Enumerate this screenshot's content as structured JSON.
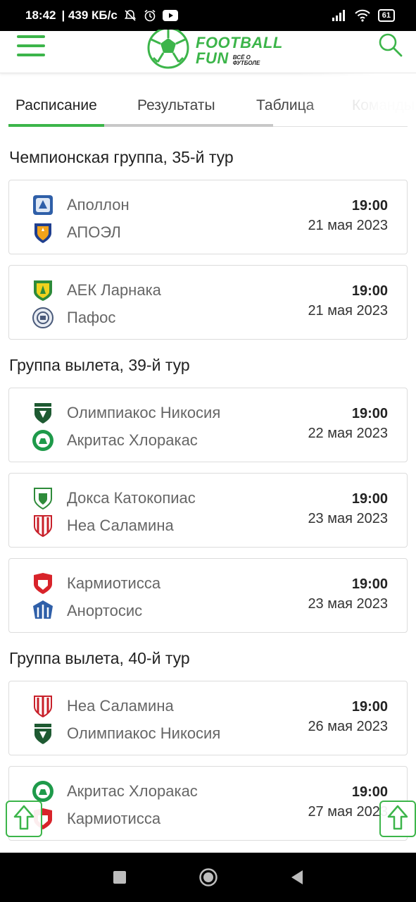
{
  "status_bar": {
    "time": "18:42",
    "speed": "| 439 КБ/с",
    "battery": "61",
    "icons": [
      "notifications-off-icon",
      "alarm-icon",
      "youtube-icon",
      "signal-icon",
      "wifi-icon",
      "battery-icon"
    ]
  },
  "header": {
    "logo_main_line1": "FOOTBALL",
    "logo_main_line2": "FUN",
    "logo_tagline_1": "ВСЁ О",
    "logo_tagline_2": "ФУТБОЛЕ",
    "accent_color": "#3cb54a",
    "menu_icon": "hamburger-menu-icon",
    "search_icon": "search-icon"
  },
  "tabs": [
    {
      "label": "Расписание",
      "active": true
    },
    {
      "label": "Результаты",
      "active": false
    },
    {
      "label": "Таблица",
      "active": false
    },
    {
      "label": "Команды",
      "active": false
    }
  ],
  "groups": [
    {
      "title": "Чемпионская группа, 35-й тур",
      "matches": [
        {
          "home": "Аполлон",
          "away": "АПОЭЛ",
          "time": "19:00",
          "date": "21 мая 2023"
        },
        {
          "home": "АЕК Ларнака",
          "away": "Пафос",
          "time": "19:00",
          "date": "21 мая 2023"
        }
      ]
    },
    {
      "title": "Группа вылета, 39-й тур",
      "matches": [
        {
          "home": "Олимпиакос Никосия",
          "away": "Акритас Хлоракас",
          "time": "19:00",
          "date": "22 мая 2023"
        },
        {
          "home": "Докса Катокопиас",
          "away": "Неа Саламина",
          "time": "19:00",
          "date": "23 мая 2023"
        },
        {
          "home": "Кармиотисса",
          "away": "Анортосис",
          "time": "19:00",
          "date": "23 мая 2023"
        }
      ]
    },
    {
      "title": "Группа вылета, 40-й тур",
      "matches": [
        {
          "home": "Неа Саламина",
          "away": "Олимпиакос Никосия",
          "time": "19:00",
          "date": "26 мая 2023"
        },
        {
          "home": "Акритас Хлоракас",
          "away": "Кармиотисса",
          "time": "19:00",
          "date": "27 мая 2023"
        }
      ]
    }
  ],
  "scroll_top_icon": "arrow-up-icon",
  "nav_bar": {
    "icons": [
      "recents-square-icon",
      "home-circle-icon",
      "back-triangle-icon"
    ]
  }
}
